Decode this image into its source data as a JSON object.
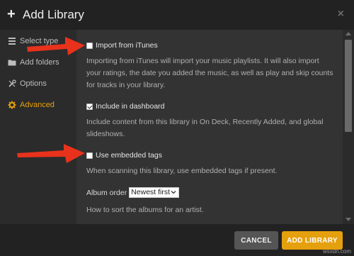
{
  "dialog": {
    "title": "Add Library",
    "plus_icon": "+",
    "close_icon": "×"
  },
  "sidebar": {
    "items": [
      {
        "label": "Select type",
        "icon": "library-icon",
        "active": false
      },
      {
        "label": "Add folders",
        "icon": "folder-icon",
        "active": false
      },
      {
        "label": "Options",
        "icon": "tools-icon",
        "active": false
      },
      {
        "label": "Advanced",
        "icon": "gear-icon",
        "active": true
      }
    ]
  },
  "options": {
    "import_itunes": {
      "label": "Import from iTunes",
      "checked": false,
      "description": "Importing from iTunes will import your music playlists. It will also import your ratings, the date you added the music, as well as play and skip counts for tracks in your library."
    },
    "include_dashboard": {
      "label": "Include in dashboard",
      "checked": true,
      "description": "Include content from this library in On Deck, Recently Added, and global slideshows."
    },
    "embedded_tags": {
      "label": "Use embedded tags",
      "checked": false,
      "description": "When scanning this library, use embedded tags if present."
    },
    "album_order": {
      "label": "Album order",
      "selected": "Newest first",
      "description": "How to sort the albums for an artist."
    }
  },
  "footer": {
    "cancel_label": "CANCEL",
    "add_label": "ADD LIBRARY"
  },
  "watermark": "wsxdn.com",
  "colors": {
    "accent": "#e5a00d",
    "arrow": "#e8321c",
    "header_bg": "#222222",
    "content_bg": "#333333"
  }
}
